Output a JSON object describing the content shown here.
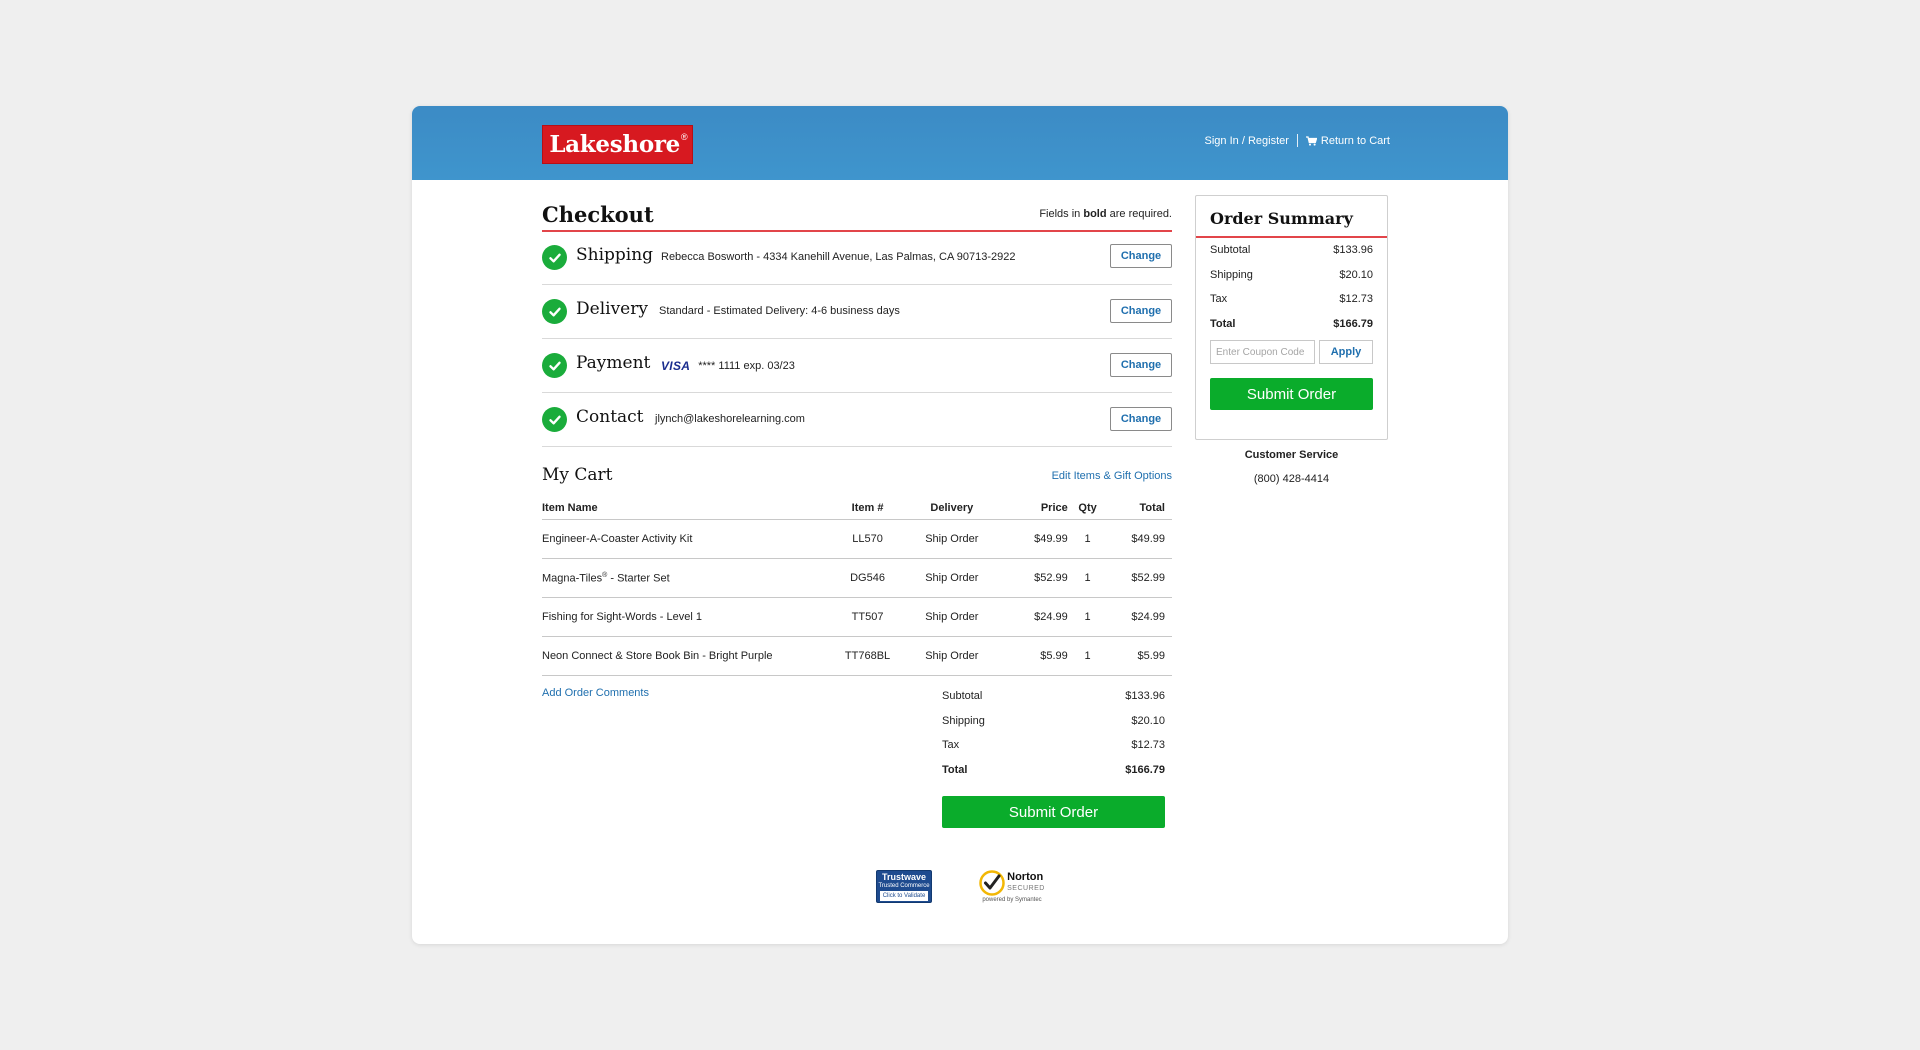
{
  "header": {
    "logo_text": "Lakeshore",
    "logo_mark": "®",
    "sign_in": "Sign In / Register",
    "return_cart": "Return to Cart",
    "cart_icon": "cart-icon",
    "colors": {
      "header_bg": "#3d8fc9",
      "logo_red": "#d71920"
    }
  },
  "checkout": {
    "title": "Checkout",
    "required_pre": "Fields in ",
    "required_bold": "bold",
    "required_post": " are required.",
    "steps": [
      {
        "label": "Shipping",
        "detail": "Rebecca Bosworth - 4334 Kanehill Avenue, Las Palmas, CA 90713-2922",
        "button": "Change",
        "icon": "check-circle-icon"
      },
      {
        "label": "Delivery",
        "detail": "Standard - Estimated Delivery: 4-6 business days",
        "button": "Change",
        "icon": "check-circle-icon"
      },
      {
        "label": "Payment",
        "card_brand": "VISA",
        "detail": "**** 1111 exp. 03/23",
        "button": "Change",
        "icon": "check-circle-icon"
      },
      {
        "label": "Contact",
        "detail": "jlynch@lakeshorelearning.com",
        "button": "Change",
        "icon": "check-circle-icon"
      }
    ],
    "accent_color": "#e2454a",
    "check_color": "#1aac3b"
  },
  "cart": {
    "title": "My Cart",
    "edit_link": "Edit Items & Gift Options",
    "columns": [
      "Item Name",
      "Item #",
      "Delivery",
      "Price",
      "Qty",
      "Total"
    ],
    "rows": [
      {
        "name": "Engineer-A-Coaster Activity Kit",
        "sup": "",
        "name_rest": "",
        "item": "LL570",
        "delivery": "Ship Order",
        "price": "$49.99",
        "qty": "1",
        "total": "$49.99"
      },
      {
        "name": "Magna-Tiles",
        "sup": "®",
        "name_rest": " - Starter Set",
        "item": "DG546",
        "delivery": "Ship Order",
        "price": "$52.99",
        "qty": "1",
        "total": "$52.99"
      },
      {
        "name": "Fishing for Sight-Words - Level 1",
        "sup": "",
        "name_rest": "",
        "item": "TT507",
        "delivery": "Ship Order",
        "price": "$24.99",
        "qty": "1",
        "total": "$24.99"
      },
      {
        "name": "Neon Connect & Store Book Bin - Bright Purple",
        "sup": "",
        "name_rest": "",
        "item": "TT768BL",
        "delivery": "Ship Order",
        "price": "$5.99",
        "qty": "1",
        "total": "$5.99"
      }
    ],
    "add_comments": "Add Order Comments",
    "totals": [
      {
        "label": "Subtotal",
        "value": "$133.96"
      },
      {
        "label": "Shipping",
        "value": "$20.10"
      },
      {
        "label": "Tax",
        "value": "$12.73"
      },
      {
        "label": "Total",
        "value": "$166.79"
      }
    ],
    "submit": "Submit Order",
    "submit_color": "#0aac2b"
  },
  "badges": {
    "trustwave_name": "Trustwave",
    "trustwave_line": "Trusted Commerce",
    "trustwave_cta": "Click to Validate",
    "norton_name": "Norton",
    "norton_secured": "SECURED",
    "norton_by": "powered by Symantec"
  },
  "summary": {
    "title": "Order Summary",
    "rows": [
      {
        "label": "Subtotal",
        "value": "$133.96"
      },
      {
        "label": "Shipping",
        "value": "$20.10"
      },
      {
        "label": "Tax",
        "value": "$12.73"
      },
      {
        "label": "Total",
        "value": "$166.79"
      }
    ],
    "coupon_placeholder": "Enter Coupon Code",
    "apply": "Apply",
    "submit": "Submit Order"
  },
  "customer_service": {
    "title": "Customer Service",
    "phone": "(800) 428-4414"
  }
}
